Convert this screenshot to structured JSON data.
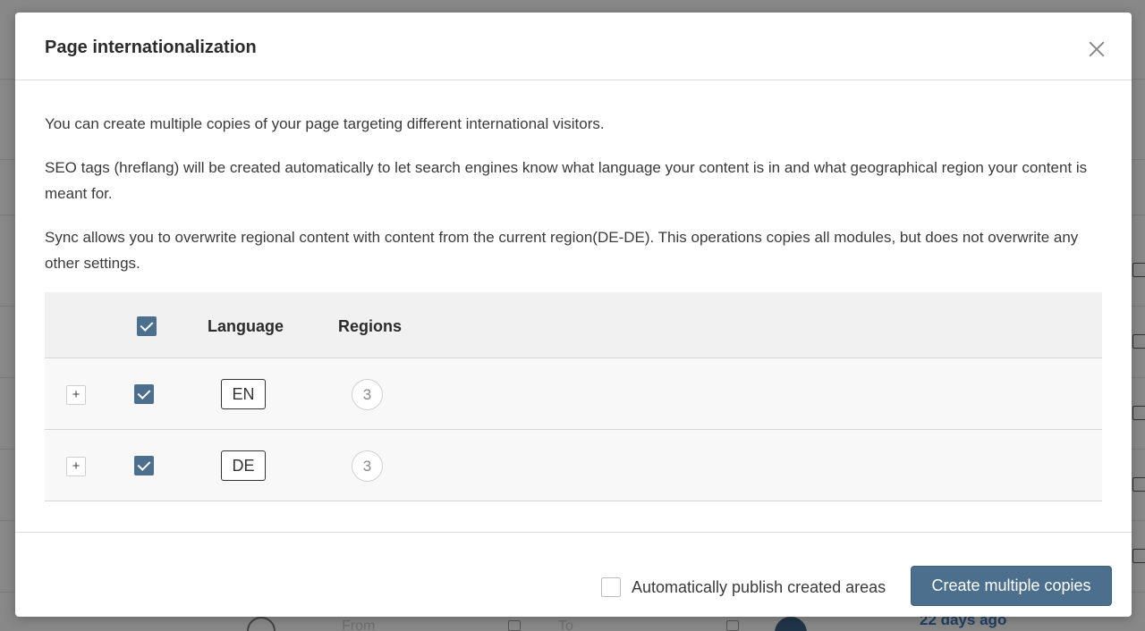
{
  "background": {
    "footer": {
      "from_placeholder": "From",
      "to_placeholder": "To",
      "last_updated": "22 days ago"
    }
  },
  "modal": {
    "title": "Page internationalization",
    "paragraphs": [
      "You can create multiple copies of your page targeting different international visitors.",
      "SEO tags (hreflang) will be created automatically to let search engines know what language your content is in and what geographical region your content is meant for.",
      "Sync allows you to overwrite regional content with content from the current region(DE-DE). This operations copies all modules, but does not overwrite any other settings."
    ],
    "table": {
      "headers": {
        "language": "Language",
        "regions": "Regions"
      },
      "select_all_checked": true,
      "rows": [
        {
          "expand_label": "+",
          "checked": true,
          "language": "EN",
          "regions": "3"
        },
        {
          "expand_label": "+",
          "checked": true,
          "language": "DE",
          "regions": "3"
        }
      ]
    },
    "footer": {
      "auto_publish_label": "Automatically publish created areas",
      "auto_publish_checked": false,
      "create_button_label": "Create multiple copies"
    }
  },
  "colors": {
    "accent": "#4d6f8e",
    "overlay": "#888888"
  }
}
